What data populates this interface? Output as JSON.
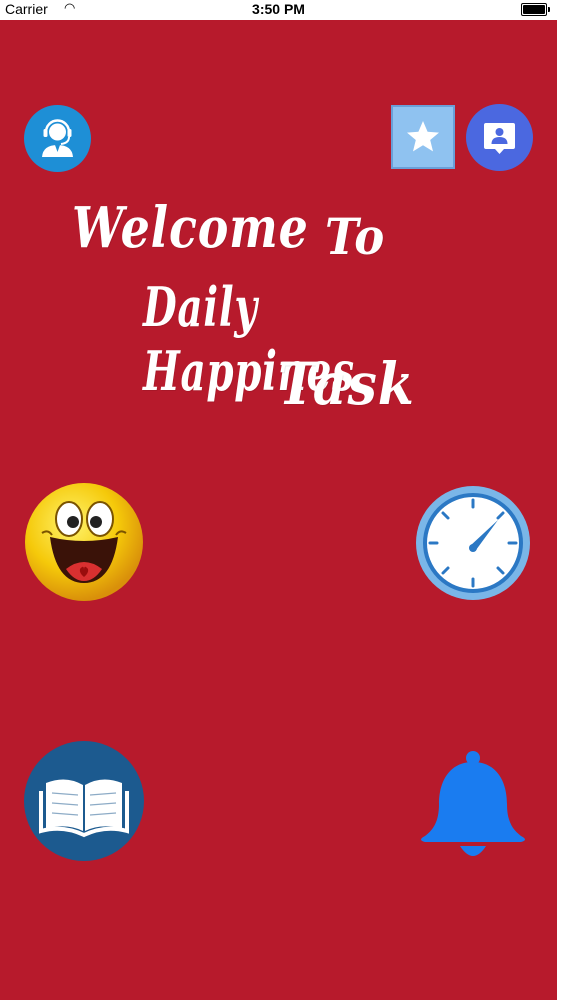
{
  "status_bar": {
    "carrier": "Carrier",
    "time": "3:50 PM"
  },
  "welcome": {
    "line1": "Welcome",
    "line2": "To",
    "line3": "Daily Happines",
    "line4": "Task"
  },
  "colors": {
    "background": "#b71a2c",
    "support": "#1e8fd6",
    "favorite": "#8fc2f0",
    "contact": "#4b68e0",
    "book": "#1c5a8f",
    "bell": "#1a7cf0"
  },
  "icons": {
    "support": "customer-support-icon",
    "favorite": "star-icon",
    "contact": "contact-card-icon",
    "mood": "smiley-icon",
    "timer": "stopwatch-icon",
    "read": "open-book-icon",
    "reminder": "bell-icon"
  }
}
